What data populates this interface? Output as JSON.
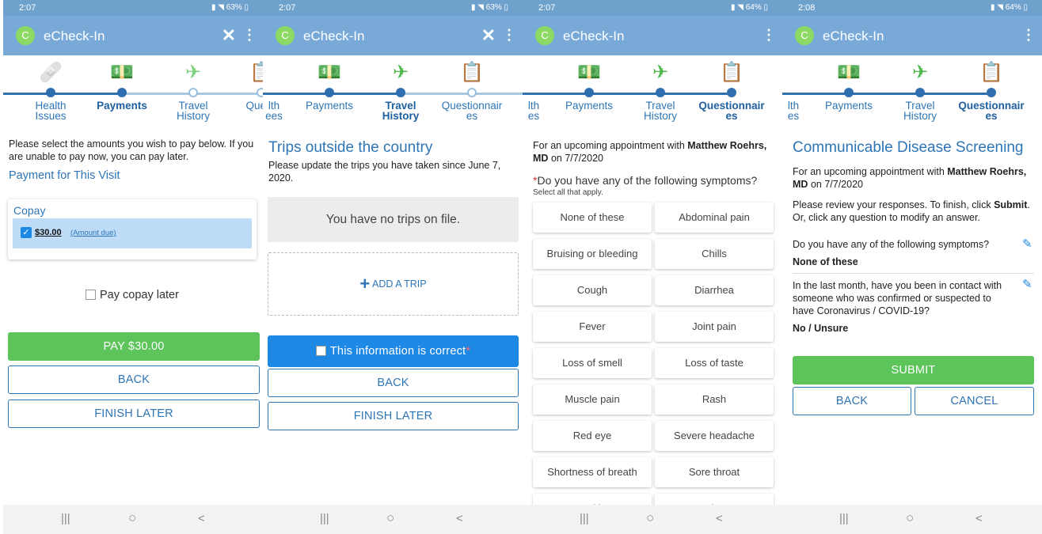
{
  "app": {
    "title": "eCheck-In",
    "logo_letter": "C"
  },
  "colors": {
    "accent": "#2e75b6",
    "appbar": "#78a9d7",
    "green": "#5cc45a",
    "blue": "#1e88e5"
  },
  "screens": [
    {
      "time": "2:07",
      "status_icons": "63%",
      "steps": [
        "Health Issues",
        "Payments",
        "Travel History",
        "Questionnaires"
      ],
      "steps_display": [
        "Health\nIssues",
        "Payments",
        "Travel\nHistory",
        "Questi"
      ],
      "intro": "Please select the amounts you wish to pay below. If you are unable to pay now, you can pay later.",
      "section_title": "Payment for This Visit",
      "copay_label": "Copay",
      "copay_amount": "$30.00",
      "copay_note": "(Amount due)",
      "pay_later": "Pay copay later",
      "pay_button": "PAY $30.00",
      "back_button": "BACK",
      "finish_later_button": "FINISH LATER"
    },
    {
      "time": "2:07",
      "status_icons": "63%",
      "step_labels": [
        "lth",
        "Payments",
        "Travel",
        "Questionnair"
      ],
      "step_labels2": [
        "ees",
        "",
        "History",
        "es"
      ],
      "heading": "Trips outside the country",
      "intro": "Please update the trips you have taken since June 7, 2020.",
      "no_trips": "You have no trips on file.",
      "add_trip": "ADD A TRIP",
      "confirm": "This information is correct",
      "back_button": "BACK",
      "finish_later_button": "FINISH LATER"
    },
    {
      "time": "2:07",
      "status_icons": "64%",
      "step_labels": [
        "lth",
        "Payments",
        "Travel",
        "Questionnair"
      ],
      "step_labels2": [
        "es",
        "",
        "History",
        "es"
      ],
      "appointment_prefix": "For an upcoming appointment with",
      "doctor": "Matthew Roehrs, MD",
      "appointment_date": "on 7/7/2020",
      "question": "Do you have any of the following symptoms?",
      "question_hint": "Select all that apply.",
      "symptoms": [
        "None of these",
        "Abdominal pain",
        "Bruising or bleeding",
        "Chills",
        "Cough",
        "Diarrhea",
        "Fever",
        "Joint pain",
        "Loss of smell",
        "Loss of taste",
        "Muscle pain",
        "Rash",
        "Red eye",
        "Severe headache",
        "Shortness of breath",
        "Sore throat",
        "Vomiting",
        "Weakness"
      ]
    },
    {
      "time": "2:08",
      "status_icons": "64%",
      "step_labels": [
        "lth",
        "Payments",
        "Travel",
        "Questionnair"
      ],
      "step_labels2": [
        "es",
        "",
        "History",
        "es"
      ],
      "heading": "Communicable Disease Screening",
      "appointment_prefix": "For an upcoming appointment with",
      "doctor": "Matthew Roehrs, MD",
      "appointment_date": "on 7/7/2020",
      "review_text_1": "Please review your responses. To finish, click",
      "review_submit_word": "Submit",
      "review_text_2": "Or, click any question to modify an answer.",
      "q1": "Do you have any of the following symptoms?",
      "a1": "None of these",
      "q2": "In the last month, have you been in contact with someone who was confirmed or suspected to have Coronavirus / COVID-19?",
      "a2": "No / Unsure",
      "submit_button": "SUBMIT",
      "back_button": "BACK",
      "cancel_button": "CANCEL"
    }
  ],
  "nav": {
    "recent": "|||",
    "home": "○",
    "back": "<"
  }
}
